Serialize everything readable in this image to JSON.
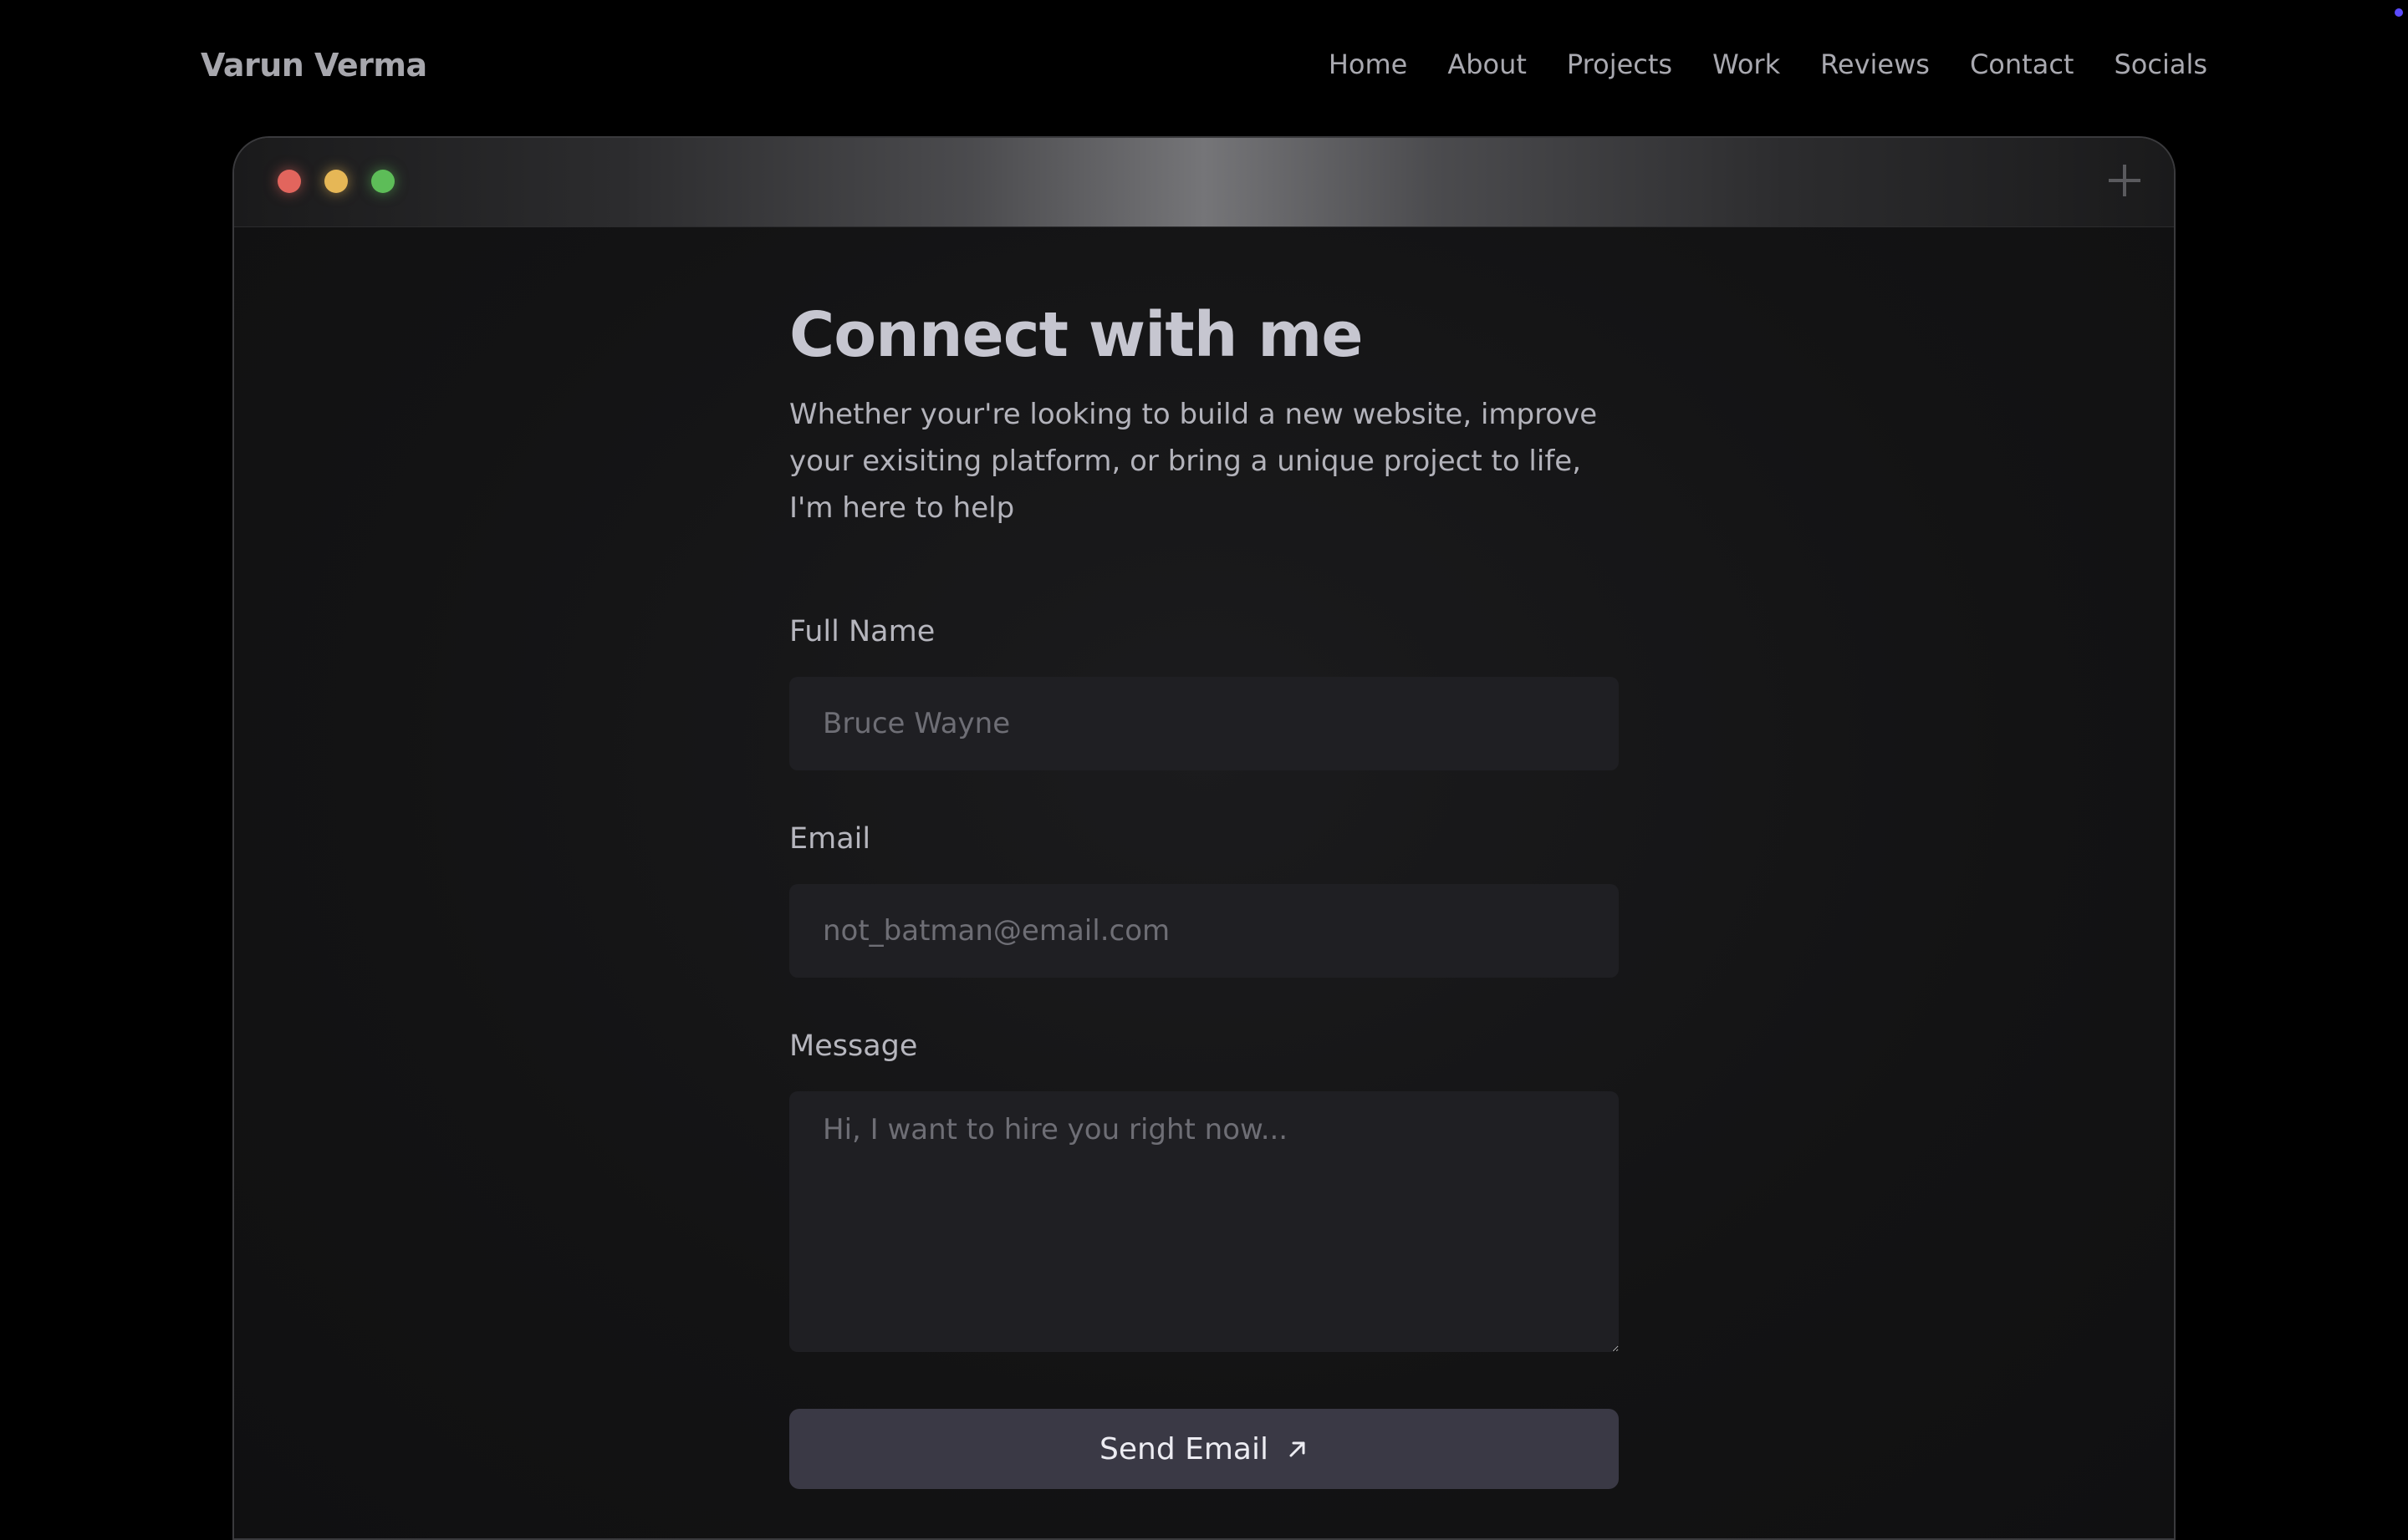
{
  "brand": {
    "name": "Varun Verma"
  },
  "nav": {
    "links": [
      "Home",
      "About",
      "Projects",
      "Work",
      "Reviews",
      "Contact",
      "Socials"
    ]
  },
  "contact": {
    "heading": "Connect with me",
    "subtitle": "Whether your're looking to build a new website, improve your exisiting platform, or bring a unique project to life, I'm here to help",
    "full_name": {
      "label": "Full Name",
      "placeholder": "Bruce Wayne"
    },
    "email": {
      "label": "Email",
      "placeholder": "not_batman@email.com"
    },
    "message": {
      "label": "Message",
      "placeholder": "Hi, I want to hire you right now..."
    },
    "submit_label": "Send Email"
  },
  "icons": {
    "submit": "arrow-up-right-icon",
    "window_add": "plus-icon"
  },
  "colors": {
    "background": "#000000",
    "window_body": "#131314",
    "input_bg": "#1f1f23",
    "button_bg": "#3a3945",
    "traffic_red": "#e2655d",
    "traffic_yellow": "#e6b756",
    "traffic_green": "#5dbd58",
    "accent_dot": "#5b4bff"
  }
}
